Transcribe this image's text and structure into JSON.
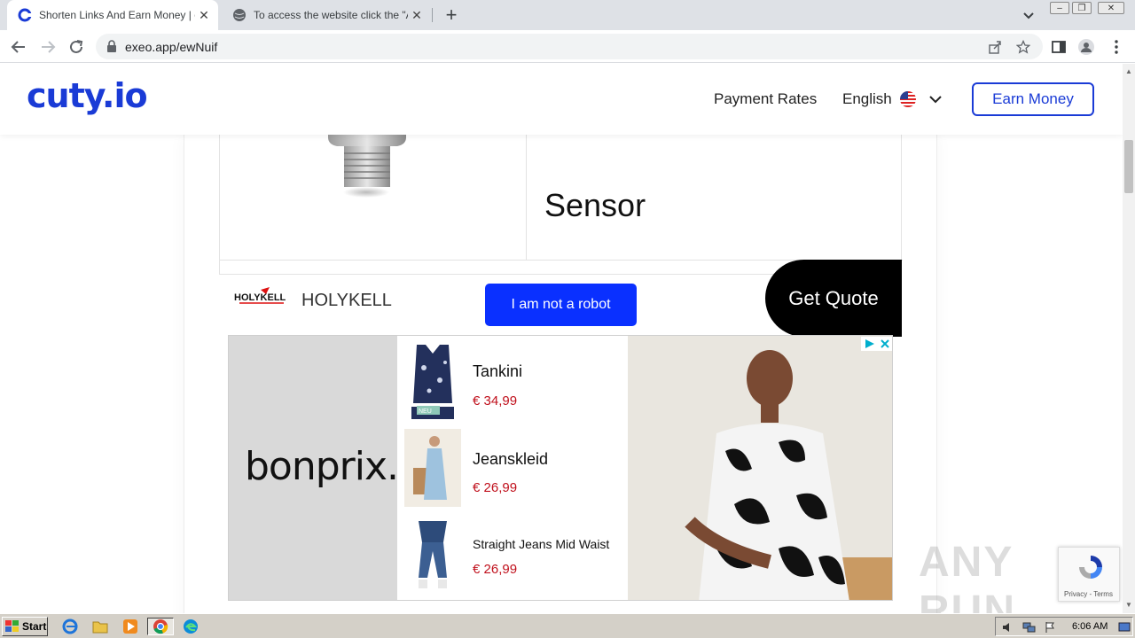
{
  "browser": {
    "tabs": [
      {
        "title": "Shorten Links And Earn Money | cuty.io",
        "active": true
      },
      {
        "title": "To access the website click the \"Allow\"",
        "active": false
      }
    ],
    "new_tab": "+",
    "url": "exeo.app/ewNuif"
  },
  "site": {
    "logo": "cuty.io",
    "nav": {
      "payment_rates": "Payment Rates",
      "language": "English",
      "earn_money": "Earn Money"
    }
  },
  "ad_holykell": {
    "headline": "Sensor",
    "brand_logo_text": "HOLYKELL",
    "brand": "HOLYKELL",
    "cta": "Get Quote"
  },
  "captcha_button": "I am not a robot",
  "ad_bonprix": {
    "brand": "bonprix.",
    "products": [
      {
        "name": "Tankini",
        "price": "€ 34,99",
        "badge": "NEU"
      },
      {
        "name": "Jeanskleid",
        "price": "€ 26,99"
      },
      {
        "name": "Straight Jeans Mid Waist",
        "price": "€ 26,99"
      }
    ]
  },
  "recaptcha": {
    "links": "Privacy - Terms"
  },
  "watermark": "ANY RUN",
  "taskbar": {
    "start": "Start",
    "clock": "6:06 AM"
  },
  "colors": {
    "brand_blue": "#1a3bd6",
    "robot_button": "#0a30ff",
    "price_red": "#c0101c"
  }
}
